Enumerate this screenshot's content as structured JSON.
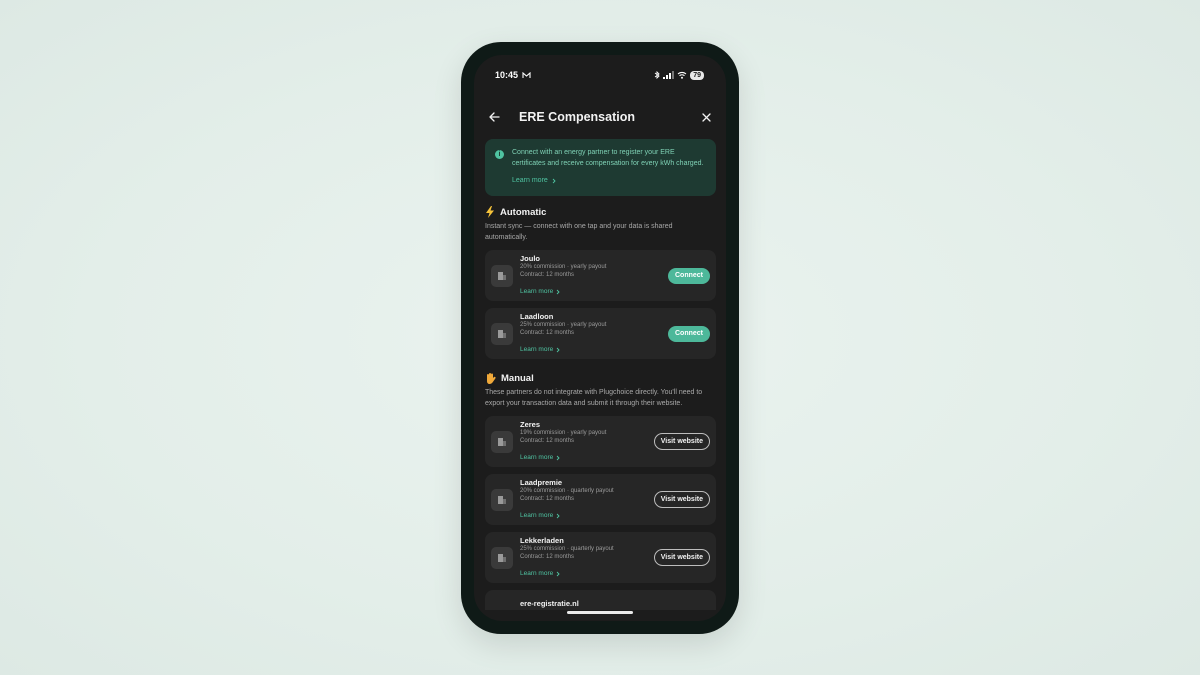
{
  "status_bar": {
    "time": "10:45",
    "battery": "79"
  },
  "header": {
    "title": "ERE Compensation"
  },
  "info": {
    "text": "Connect with an energy partner to register your ERE certificates and receive compensation for every kWh charged.",
    "learn_more": "Learn more"
  },
  "automatic": {
    "title": "Automatic",
    "icon": "lightning-icon",
    "description": "Instant sync — connect with one tap and your data is shared automatically.",
    "partners": [
      {
        "name": "Joulo",
        "terms": "20% commission · yearly payout",
        "contract": "Contract: 12 months",
        "learn_more": "Learn more",
        "action": "Connect"
      },
      {
        "name": "Laadloon",
        "terms": "25% commission · yearly payout",
        "contract": "Contract: 12 months",
        "learn_more": "Learn more",
        "action": "Connect"
      }
    ]
  },
  "manual": {
    "title": "Manual",
    "icon": "hand-icon",
    "description": "These partners do not integrate with Plugchoice directly. You'll need to export your transaction data and submit it through their website.",
    "partners": [
      {
        "name": "Zeres",
        "terms": "19% commission · yearly payout",
        "contract": "Contract: 12 months",
        "learn_more": "Learn more",
        "action": "Visit website"
      },
      {
        "name": "Laadpremie",
        "terms": "20% commission · quarterly payout",
        "contract": "Contract: 12 months",
        "learn_more": "Learn more",
        "action": "Visit website"
      },
      {
        "name": "Lekkerladen",
        "terms": "25% commission · quarterly payout",
        "contract": "Contract: 12 months",
        "learn_more": "Learn more",
        "action": "Visit website"
      }
    ],
    "peek_name": "ere-registratie.nl"
  },
  "colors": {
    "accent": "#4fc3a1",
    "card": "#262626",
    "screen": "#1c1c1c",
    "info_bg": "#1e3a32"
  }
}
